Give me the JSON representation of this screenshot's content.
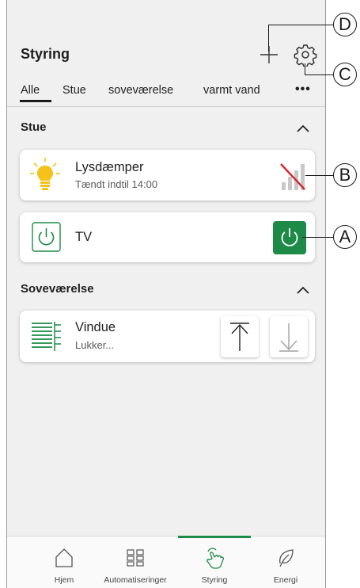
{
  "header": {
    "title": "Styring"
  },
  "tabs": [
    {
      "label": "Alle"
    },
    {
      "label": "Stue"
    },
    {
      "label": "soveværelse"
    },
    {
      "label": "varmt vand"
    }
  ],
  "more_label": "•••",
  "sections": [
    {
      "title": "Stue",
      "devices": [
        {
          "name": "Lysdæmper",
          "status": "Tændt indtil 14:00",
          "icon": "bulb-icon"
        },
        {
          "name": "TV",
          "icon": "power-icon"
        }
      ]
    },
    {
      "title": "Soveværelse",
      "devices": [
        {
          "name": "Vindue",
          "status": "Lukker...",
          "icon": "blinds-icon"
        }
      ]
    }
  ],
  "bottom_nav": [
    {
      "label": "Hjem",
      "icon": "home-icon"
    },
    {
      "label": "Automatiseringer",
      "icon": "grid-icon"
    },
    {
      "label": "Styring",
      "icon": "hand-touch-icon",
      "active": true
    },
    {
      "label": "Energi",
      "icon": "leaf-icon"
    }
  ],
  "callouts": [
    "D",
    "C",
    "B",
    "A"
  ],
  "colors": {
    "accent": "#1d8a47",
    "bulb": "#f4c21b",
    "no_signal": "#d9232a"
  }
}
